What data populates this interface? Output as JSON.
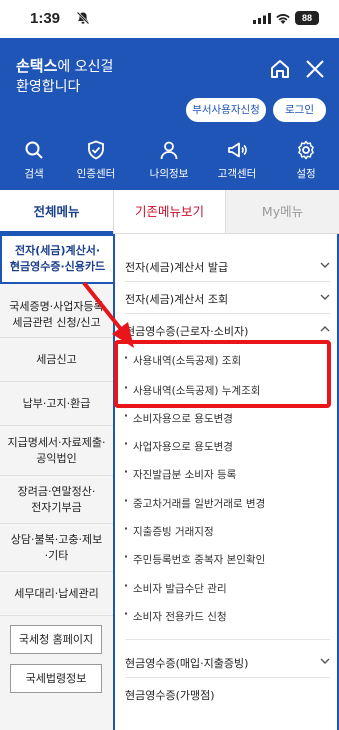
{
  "status_bar": {
    "time": "1:39",
    "battery": "88"
  },
  "header": {
    "greeting_name": "손택스",
    "greeting_suffix": "에 오신걸",
    "greeting_line2": "환영합니다",
    "buttons": [
      "부서사용자신청",
      "로그인"
    ],
    "shortcuts": [
      "검색",
      "인증센터",
      "나의정보",
      "고객센터",
      "설정"
    ]
  },
  "tabs": [
    "전체메뉴",
    "기존메뉴보기",
    "My메뉴"
  ],
  "left_menu": [
    {
      "label": "전자(세금)계산서·\n현금영수증·신용카드"
    },
    {
      "label": "국세증명·사업자등록\n세금관련 신청/신고"
    },
    {
      "label": "세금신고"
    },
    {
      "label": "납부·고지·환급"
    },
    {
      "label": "지급명세서·자료제출·\n공익법인"
    },
    {
      "label": "장려금·연말정산·\n전자기부금"
    },
    {
      "label": "상담·불복·고충·제보\n·기타"
    },
    {
      "label": "세무대리·납세관리"
    }
  ],
  "left_buttons": [
    "국세청 홈페이지",
    "국세법령정보"
  ],
  "right_menu": {
    "sections": [
      "전자(세금)계산서 발급",
      "전자(세금)계산서 조회",
      "현금영수증(근로자·소비자)",
      "현금영수증(매입·지출증빙)",
      "현금영수증(가맹점)"
    ],
    "sub_items": [
      "사용내역(소득공제) 조회",
      "사용내역(소득공제) 누계조회",
      "소비자용으로 용도변경",
      "사업자용으로 용도변경",
      "자진발급분 소비자 등록",
      "중고차거래를 일반거래로 변경",
      "지출증빙 거래지정",
      "주민등록번호 중복자 본인확인",
      "소비자 발급수단 관리",
      "소비자 전용카드 신청"
    ]
  },
  "colors": {
    "brand_blue": "#1f55b7",
    "highlight_red": "#e8161b",
    "tab_red": "#c8102e"
  }
}
